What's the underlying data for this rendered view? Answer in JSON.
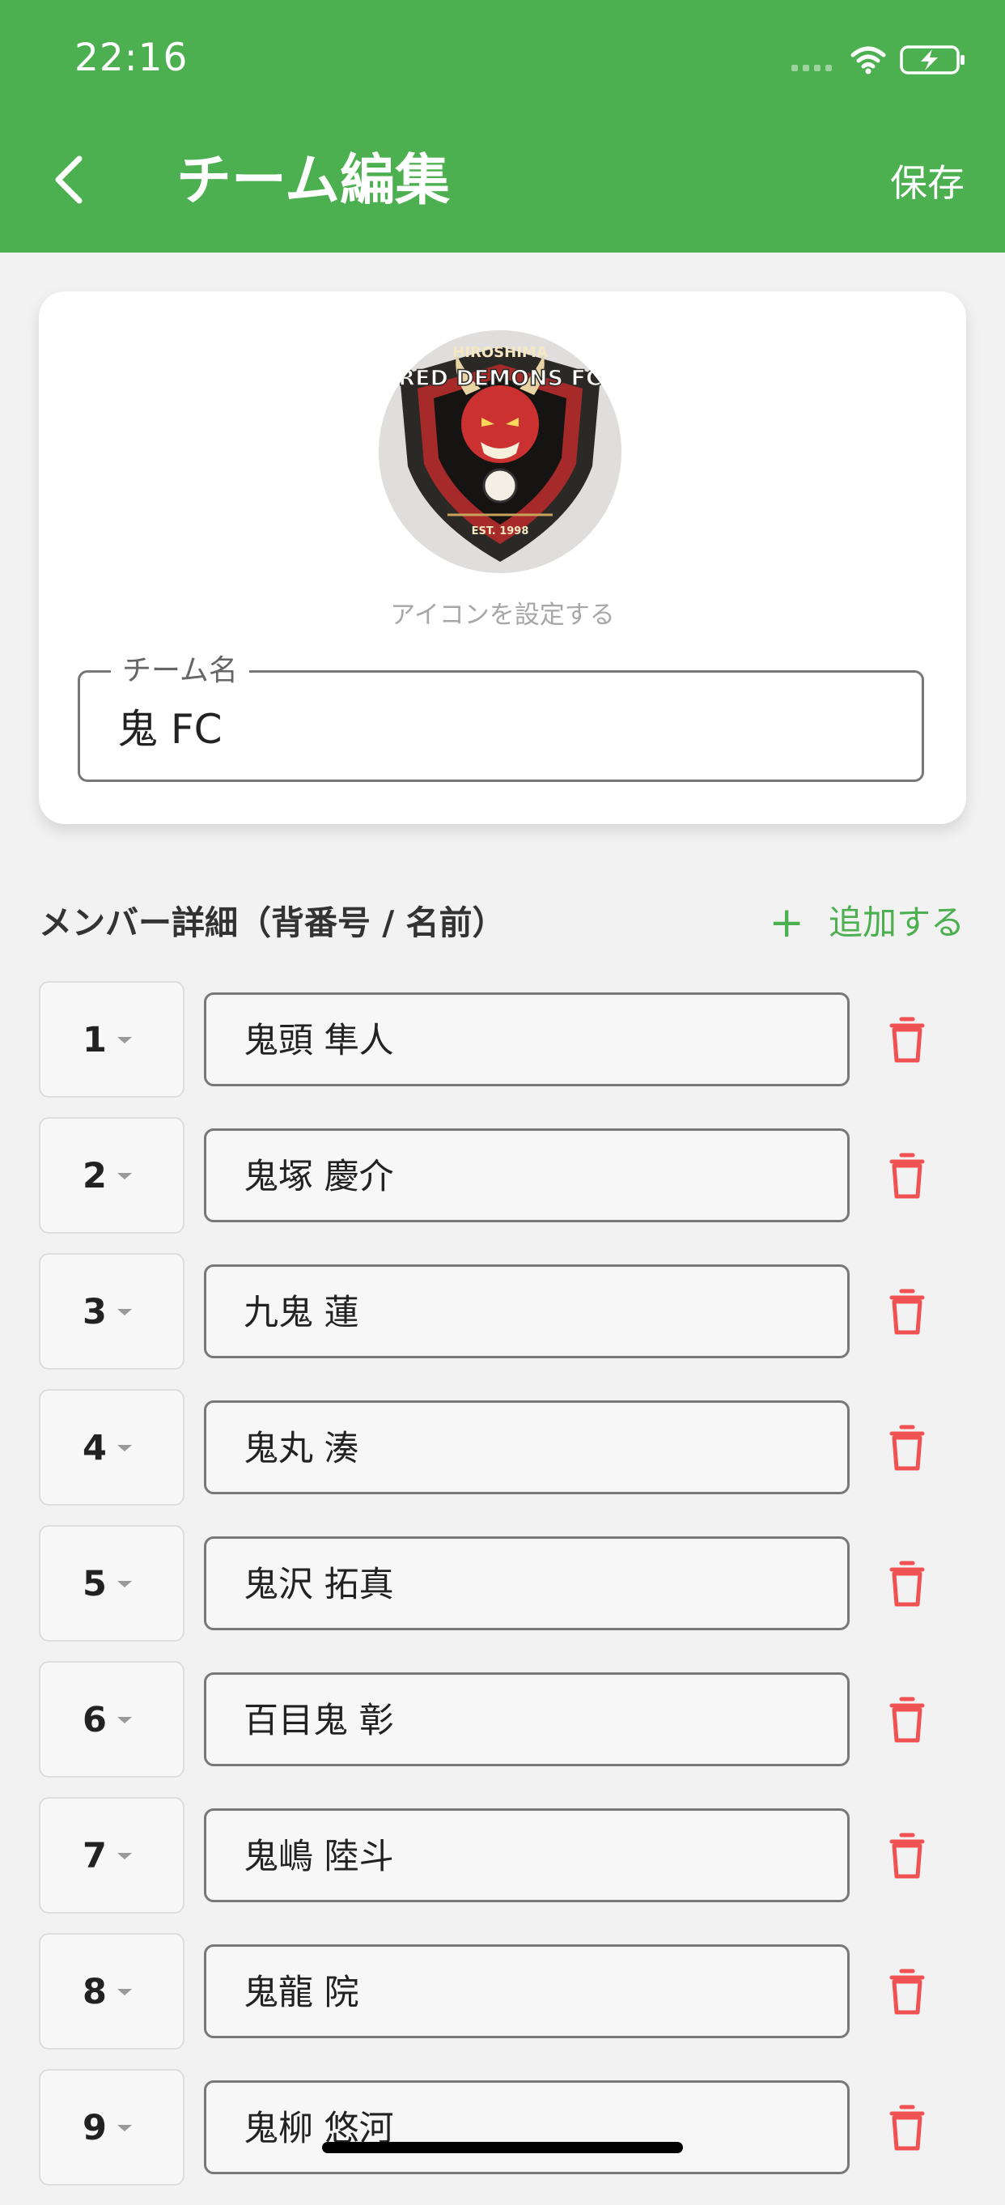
{
  "status_bar": {
    "time": "22:16"
  },
  "header": {
    "title": "チーム編集",
    "save_label": "保存",
    "back_icon": "chevron-left-icon"
  },
  "team_card": {
    "icon_caption": "アイコンを設定する",
    "team_name_label": "チーム名",
    "team_name_value": "鬼 FC",
    "logo": {
      "top_text": "HIROSHIMA",
      "main_text": "RED DEMONS FC",
      "est_text": "EST. 1998"
    }
  },
  "members_section": {
    "title": "メンバー詳細（背番号 / 名前）",
    "add_label": "追加する",
    "members": [
      {
        "number": "1",
        "name": "鬼頭 隼人"
      },
      {
        "number": "2",
        "name": "鬼塚 慶介"
      },
      {
        "number": "3",
        "name": "九鬼 蓮"
      },
      {
        "number": "4",
        "name": "鬼丸 湊"
      },
      {
        "number": "5",
        "name": "鬼沢 拓真"
      },
      {
        "number": "6",
        "name": "百目鬼 彰"
      },
      {
        "number": "7",
        "name": "鬼嶋 陸斗"
      },
      {
        "number": "8",
        "name": "鬼龍 院"
      },
      {
        "number": "9",
        "name": "鬼柳 悠河"
      }
    ]
  },
  "colors": {
    "accent": "#4caf50",
    "danger": "#f05252"
  }
}
